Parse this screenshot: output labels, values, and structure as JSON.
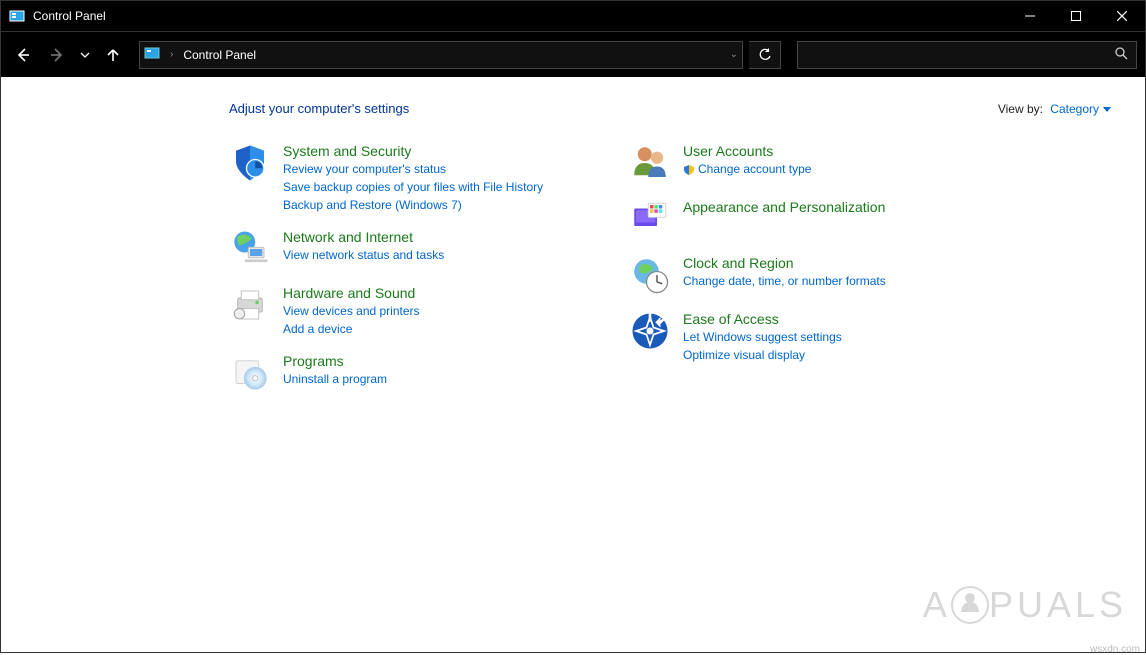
{
  "titlebar": {
    "title": "Control Panel"
  },
  "address": {
    "location": "Control Panel"
  },
  "header": {
    "heading": "Adjust your computer's settings",
    "viewby_label": "View by:",
    "viewby_value": "Category"
  },
  "left": {
    "system": {
      "title": "System and Security",
      "l1": "Review your computer's status",
      "l2": "Save backup copies of your files with File History",
      "l3": "Backup and Restore (Windows 7)"
    },
    "network": {
      "title": "Network and Internet",
      "l1": "View network status and tasks"
    },
    "hardware": {
      "title": "Hardware and Sound",
      "l1": "View devices and printers",
      "l2": "Add a device"
    },
    "programs": {
      "title": "Programs",
      "l1": "Uninstall a program"
    }
  },
  "right": {
    "users": {
      "title": "User Accounts",
      "l1": "Change account type"
    },
    "appearance": {
      "title": "Appearance and Personalization"
    },
    "clock": {
      "title": "Clock and Region",
      "l1": "Change date, time, or number formats"
    },
    "ease": {
      "title": "Ease of Access",
      "l1": "Let Windows suggest settings",
      "l2": "Optimize visual display"
    }
  },
  "watermark": {
    "brand_a": "A",
    "brand_b": "PUALS",
    "site": "wsxdn.com"
  }
}
